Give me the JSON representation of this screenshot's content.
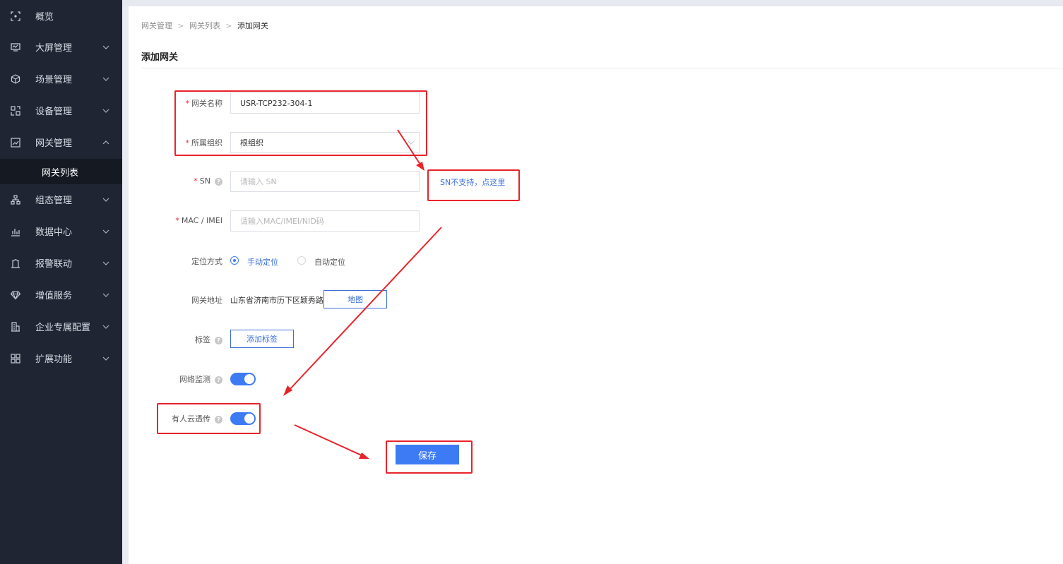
{
  "sidebar": {
    "items": [
      {
        "label": "概览",
        "icon": "overview-icon"
      },
      {
        "label": "大屏管理",
        "icon": "screen-icon"
      },
      {
        "label": "场景管理",
        "icon": "cube-icon"
      },
      {
        "label": "设备管理",
        "icon": "device-icon"
      },
      {
        "label": "网关管理",
        "icon": "gateway-icon"
      },
      {
        "label": "组态管理",
        "icon": "hierarchy-icon"
      },
      {
        "label": "数据中心",
        "icon": "bar-chart-icon"
      },
      {
        "label": "报警联动",
        "icon": "alarm-icon"
      },
      {
        "label": "增值服务",
        "icon": "diamond-icon"
      },
      {
        "label": "企业专属配置",
        "icon": "building-icon"
      },
      {
        "label": "扩展功能",
        "icon": "grid-icon"
      }
    ],
    "sub_active": "网关列表"
  },
  "breadcrumb": [
    "网关管理",
    "网关列表",
    "添加网关"
  ],
  "page_title": "添加网关",
  "form": {
    "name": {
      "label": "网关名称",
      "value": "USR-TCP232-304-1"
    },
    "org": {
      "label": "所属组织",
      "value": "根组织"
    },
    "sn": {
      "label": "SN",
      "placeholder": "请输入 SN",
      "link": "SN不支持，点这里"
    },
    "mac": {
      "label": "MAC / IMEI",
      "placeholder": "请输入MAC/IMEI/NID码"
    },
    "locate": {
      "label": "定位方式",
      "options": [
        "手动定位",
        "自动定位"
      ],
      "selected": "手动定位"
    },
    "address": {
      "label": "网关地址",
      "value": "山东省济南市历下区颖秀路",
      "map_button": "地图"
    },
    "tags": {
      "label": "标签",
      "button": "添加标签"
    },
    "network_monitor": {
      "label": "网络监测",
      "on": true
    },
    "cloud_passthrough": {
      "label": "有人云透传",
      "on": true
    },
    "save_button": "保存"
  },
  "colors": {
    "sidebar_bg": "#1f2533",
    "primary": "#3d7bf5",
    "link": "#3b6fd8",
    "required": "#f5222d",
    "annotation": "#e8232a"
  }
}
